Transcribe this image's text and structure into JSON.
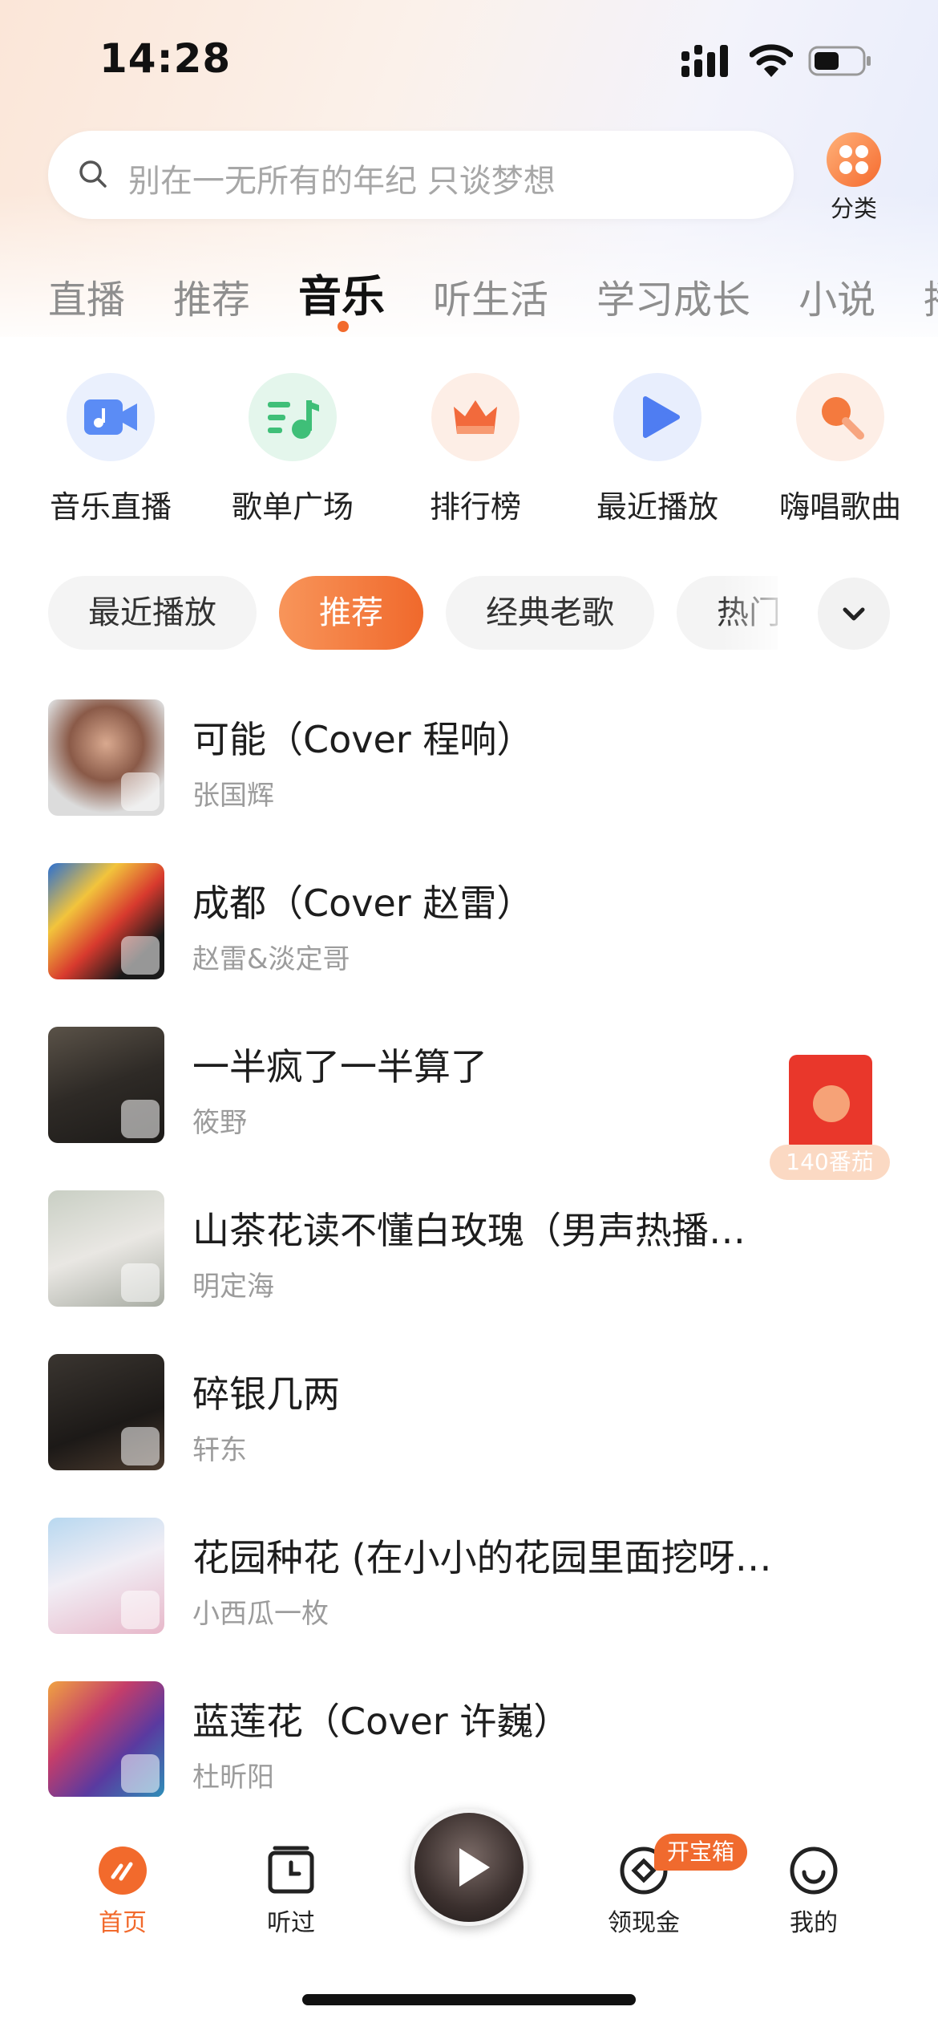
{
  "status": {
    "time": "14:28"
  },
  "search": {
    "placeholder": "别在一无所有的年纪 只谈梦想"
  },
  "category_label": "分类",
  "tabs": [
    {
      "label": "直播"
    },
    {
      "label": "推荐"
    },
    {
      "label": "音乐"
    },
    {
      "label": "听生活"
    },
    {
      "label": "学习成长"
    },
    {
      "label": "小说"
    },
    {
      "label": "播"
    }
  ],
  "active_tab": "音乐",
  "shortcuts": [
    {
      "label": "音乐直播",
      "icon": "video-camera-icon",
      "color": "#5b8cf5"
    },
    {
      "label": "歌单广场",
      "icon": "playlist-icon",
      "color": "#3fbf78"
    },
    {
      "label": "排行榜",
      "icon": "crown-icon",
      "color": "#f26a3c"
    },
    {
      "label": "最近播放",
      "icon": "play-icon",
      "color": "#4f7df2"
    },
    {
      "label": "嗨唱歌曲",
      "icon": "microphone-icon",
      "color": "#f47a3e"
    }
  ],
  "chips": [
    {
      "label": "最近播放"
    },
    {
      "label": "推荐"
    },
    {
      "label": "经典老歌"
    },
    {
      "label": "热门"
    }
  ],
  "active_chip": "推荐",
  "songs": [
    {
      "title": "可能（Cover 程响）",
      "artist": "张国辉"
    },
    {
      "title": "成都（Cover 赵雷）",
      "artist": "赵雷&淡定哥"
    },
    {
      "title": "一半疯了一半算了",
      "artist": "筱野"
    },
    {
      "title": "山茶花读不懂白玫瑰（男声热播…",
      "artist": "明定海"
    },
    {
      "title": "碎银几两",
      "artist": "轩东"
    },
    {
      "title": "花园种花 (在小小的花园里面挖呀…",
      "artist": "小西瓜一枚"
    },
    {
      "title": "蓝莲花（Cover 许巍）",
      "artist": "杜昕阳"
    }
  ],
  "red_packet": {
    "badge": "140番茄"
  },
  "nav": {
    "home": "首页",
    "history": "听过",
    "cash": "领现金",
    "cash_badge": "开宝箱",
    "me": "我的"
  },
  "colors": {
    "accent": "#f26a2c"
  }
}
